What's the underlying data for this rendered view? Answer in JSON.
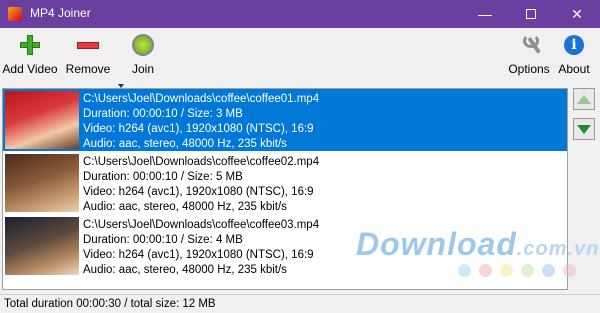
{
  "window": {
    "title": "MP4 Joiner",
    "min_glyph": "—",
    "close_glyph": "✕"
  },
  "toolbar": {
    "add_label": "Add Video",
    "remove_label": "Remove",
    "join_label": "Join",
    "options_label": "Options",
    "about_label": "About",
    "about_glyph": "i"
  },
  "videos": [
    {
      "path": "C:\\Users\\Joel\\Downloads\\coffee\\coffee01.mp4",
      "duration": "Duration: 00:00:10 / Size: 3 MB",
      "video": "Video: h264 (avc1), 1920x1080 (NTSC), 16:9",
      "audio": "Audio: aac, stereo, 48000 Hz, 235 kbit/s",
      "selected": true
    },
    {
      "path": "C:\\Users\\Joel\\Downloads\\coffee\\coffee02.mp4",
      "duration": "Duration: 00:00:10 / Size: 5 MB",
      "video": "Video: h264 (avc1), 1920x1080 (NTSC), 16:9",
      "audio": "Audio: aac, stereo, 48000 Hz, 235 kbit/s",
      "selected": false
    },
    {
      "path": "C:\\Users\\Joel\\Downloads\\coffee\\coffee03.mp4",
      "duration": "Duration: 00:00:10 / Size: 4 MB",
      "video": "Video: h264 (avc1), 1920x1080 (NTSC), 16:9",
      "audio": "Audio: aac, stereo, 48000 Hz, 235 kbit/s",
      "selected": false
    }
  ],
  "status": {
    "text": "Total duration 00:00:30 / total size: 12 MB"
  },
  "watermark": {
    "text": "Download",
    "suffix": ".com.vn"
  },
  "colors": {
    "titlebar": "#6a3fa0",
    "selection": "#0078d7",
    "dots": [
      "#8fd3f0",
      "#f2a0a0",
      "#f7e08a",
      "#b6e39a",
      "#8fb9ef",
      "#f2b0c8"
    ]
  }
}
